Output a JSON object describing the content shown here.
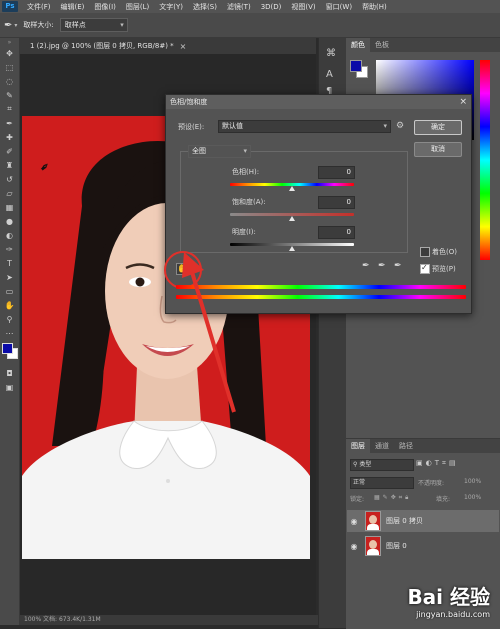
{
  "menubar": {
    "logo": "Ps",
    "items": [
      "文件(F)",
      "编辑(E)",
      "图像(I)",
      "图层(L)",
      "文字(Y)",
      "选择(S)",
      "滤镜(T)",
      "3D(D)",
      "视图(V)",
      "窗口(W)",
      "帮助(H)"
    ]
  },
  "options": {
    "sample_size_label": "取样大小:",
    "sample_size_value": "取样点"
  },
  "document": {
    "tab_title": "1 (2).jpg @ 100% (图层 0 拷贝, RGB/8#) *",
    "tab_close": "×",
    "status_text": "100%     文档: 673.4K/1.31M"
  },
  "colors": {
    "foreground": "#0a0aa8",
    "background": "#ffffff",
    "photo_bg": "#cf1d1d",
    "accent_red": "#e0302a"
  },
  "dialog": {
    "title": "色相/饱和度",
    "close": "×",
    "preset_label": "预设(E):",
    "preset_value": "默认值",
    "channel_value": "全图",
    "ok": "确定",
    "cancel": "取消",
    "hue_label": "色相(H):",
    "hue_value": "0",
    "saturation_label": "饱和度(A):",
    "saturation_value": "0",
    "lightness_label": "明度(I):",
    "lightness_value": "0",
    "colorize_label": "着色(O)",
    "colorize_checked": false,
    "preview_label": "预览(P)",
    "preview_checked": true
  },
  "color_panel": {
    "tabs": [
      "颜色",
      "色板"
    ]
  },
  "layers_panel": {
    "tabs": [
      "图层",
      "通道",
      "路径"
    ],
    "kind_filter": "类型",
    "blend_mode": "正常",
    "opacity_label": "不透明度:",
    "opacity_value": "100%",
    "lock_label": "锁定:",
    "fill_label": "填充:",
    "fill_value": "100%",
    "layers": [
      {
        "name": "图层 0 拷贝",
        "selected": true
      },
      {
        "name": "图层 0",
        "selected": false
      }
    ]
  },
  "watermark": {
    "brand": "Bai 经验",
    "url": "jingyan.baidu.com"
  }
}
